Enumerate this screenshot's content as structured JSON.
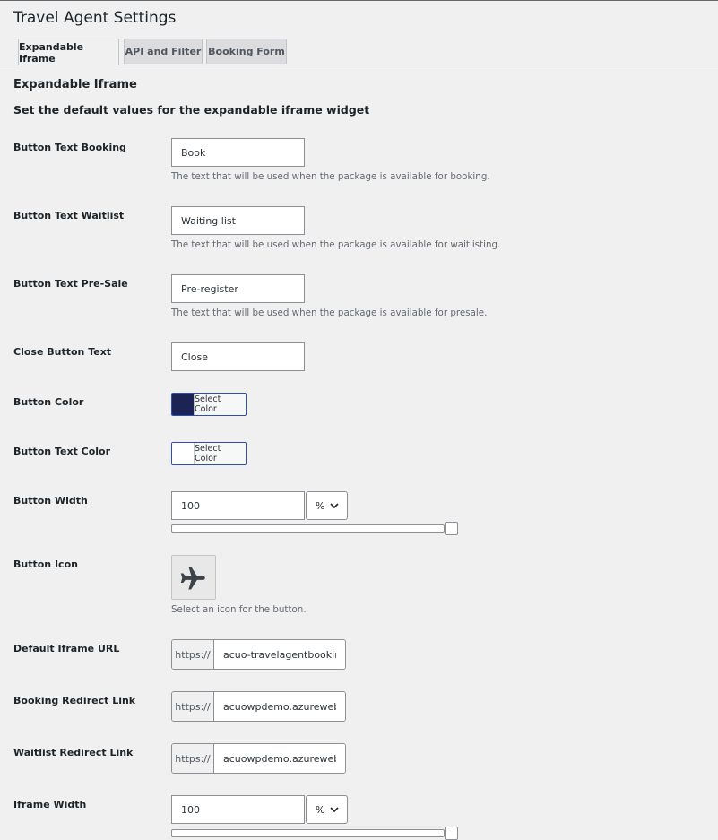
{
  "page": {
    "title": "Travel Agent Settings"
  },
  "tabs": [
    {
      "label": "Expandable Iframe",
      "active": true
    },
    {
      "label": "API and Filter",
      "active": false
    },
    {
      "label": "Booking Form",
      "active": false
    }
  ],
  "section": {
    "title": "Expandable Iframe",
    "description": "Set the default values for the expandable iframe widget"
  },
  "fields": {
    "button_text_booking": {
      "label": "Button Text Booking",
      "value": "Book",
      "help": "The text that will be used when the package is available for booking."
    },
    "button_text_waitlist": {
      "label": "Button Text Waitlist",
      "value": "Waiting list",
      "help": "The text that will be used when the package is available for waitlisting."
    },
    "button_text_presale": {
      "label": "Button Text Pre-Sale",
      "value": "Pre-register",
      "help": "The text that will be used when the package is available for presale."
    },
    "close_button_text": {
      "label": "Close Button Text",
      "value": "Close"
    },
    "button_color": {
      "label": "Button Color",
      "button_label": "Select Color",
      "color": "#1b2453"
    },
    "button_text_color": {
      "label": "Button Text Color",
      "button_label": "Select Color",
      "color": "#ffffff"
    },
    "button_width": {
      "label": "Button Width",
      "value": "100",
      "unit": "%",
      "slider_fraction": 1.0
    },
    "button_icon": {
      "label": "Button Icon",
      "icon": "airplane-icon",
      "help": "Select an icon for the button."
    },
    "default_iframe_url": {
      "label": "Default Iframe URL",
      "prefix": "https://",
      "value": "acuo-travelagentbookings"
    },
    "booking_redirect_link": {
      "label": "Booking Redirect Link",
      "prefix": "https://",
      "value": "acuowpdemo.azurewebsit"
    },
    "waitlist_redirect_link": {
      "label": "Waitlist Redirect Link",
      "prefix": "https://",
      "value": "acuowpdemo.azurewebsit"
    },
    "iframe_width": {
      "label": "Iframe Width",
      "value": "100",
      "unit": "%"
    }
  },
  "colors": {
    "accent": "#2b4fb5",
    "icon": "#3c434a"
  }
}
